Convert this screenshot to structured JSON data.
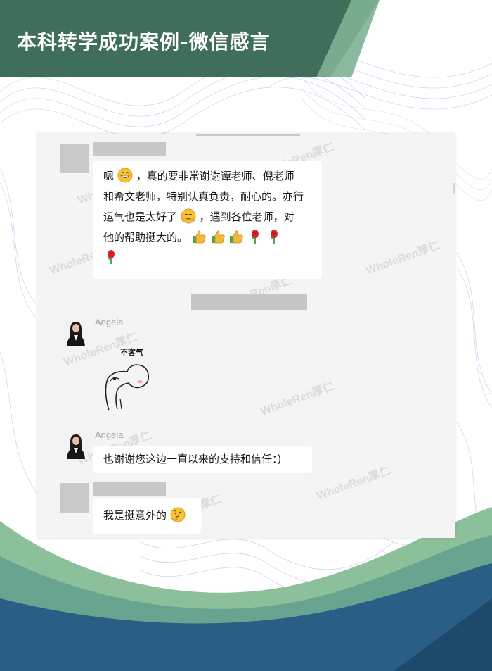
{
  "header": {
    "title": "本科转学成功案例-微信感言"
  },
  "chat": {
    "messages": [
      {
        "sender": "",
        "text_part1": "嗯",
        "text_part2": "，真的要非常谢谢谭老师、倪老师",
        "text_line2": "和希文老师，特别认真负责，耐心的。亦行",
        "text_line3a": "运气也是太好了",
        "text_line3b": "，遇到各位老师，对",
        "text_line4": "他的帮助挺大的。"
      },
      {
        "sender": "Angela",
        "sticker_text": "不客气"
      },
      {
        "sender": "Angela",
        "text": "也谢谢您这边一直以来的支持和信任：)"
      },
      {
        "sender": "",
        "text": "我是挺意外的"
      }
    ]
  },
  "watermark_text": "WholeRen厚仁",
  "colors": {
    "banner": "#3f6f5a",
    "banner_accent": "#7fb393",
    "wave_dark": "#2a5f85",
    "wave_green": "#8cc09b",
    "panel": "#f4f4f4"
  },
  "icons": [
    "grin-emoji",
    "hug-emoji",
    "thumbs-up-emoji",
    "rose-emoji",
    "thinking-emoji"
  ]
}
